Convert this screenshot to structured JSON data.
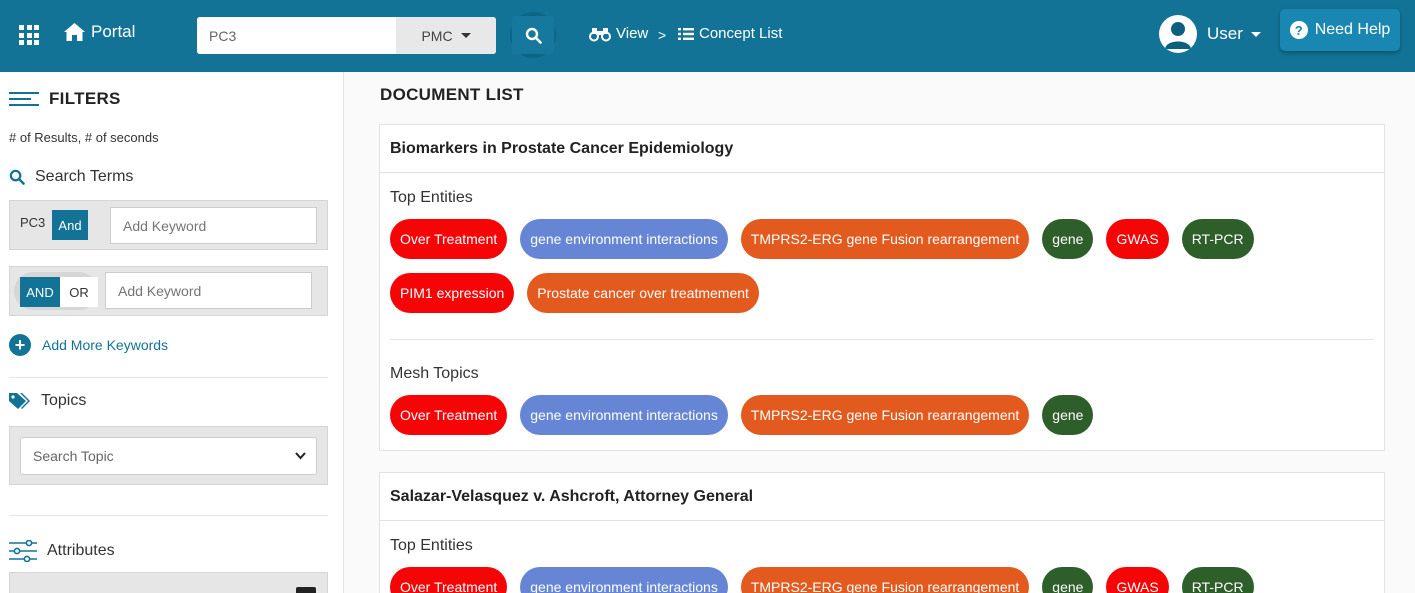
{
  "header": {
    "app_name": "Portal",
    "search": {
      "value": "PC3",
      "placeholder": ""
    },
    "source": "PMC",
    "breadcrumb": {
      "view": "View",
      "separator": ">",
      "concept_list": "Concept List"
    },
    "user": "User",
    "help": "Need Help",
    "help_mark": "?"
  },
  "sidebar": {
    "title": "FILTERS",
    "results_info": "# of Results, # of seconds",
    "search_terms_title": "Search Terms",
    "term1": {
      "keyword": "PC3",
      "operator": "And",
      "placeholder": "Add Keyword"
    },
    "term2": {
      "and_label": "AND",
      "or_label": "OR",
      "placeholder": "Add Keyword"
    },
    "add_more": "Add More Keywords",
    "topics_title": "Topics",
    "topic_placeholder": "Search Topic",
    "attributes_title": "Attributes"
  },
  "main": {
    "title": "DOCUMENT LIST",
    "documents": [
      {
        "title": "Biomarkers in Prostate Cancer Epidemiology",
        "top_entities_label": "Top Entities",
        "top_entities": [
          {
            "label": "Over Treatment",
            "color": "#f50505"
          },
          {
            "label": "gene environment interactions",
            "color": "#6685d4"
          },
          {
            "label": "TMPRS2-ERG gene Fusion rearrangement",
            "color": "#e35a1e"
          },
          {
            "label": "gene",
            "color": "#2e5f2b"
          },
          {
            "label": "GWAS",
            "color": "#f50505"
          },
          {
            "label": "RT-PCR",
            "color": "#2e5f2b"
          },
          {
            "label": "PIM1 expression",
            "color": "#f50505"
          },
          {
            "label": "Prostate cancer over treatmement",
            "color": "#e35a1e"
          }
        ],
        "mesh_label": "Mesh Topics",
        "mesh_topics": [
          {
            "label": "Over Treatment",
            "color": "#f50505"
          },
          {
            "label": "gene environment interactions",
            "color": "#6685d4"
          },
          {
            "label": "TMPRS2-ERG gene Fusion rearrangement",
            "color": "#e35a1e"
          },
          {
            "label": "gene",
            "color": "#2e5f2b"
          }
        ]
      },
      {
        "title": "Salazar-Velasquez v. Ashcroft, Attorney General",
        "top_entities_label": "Top Entities",
        "top_entities": [
          {
            "label": "Over Treatment",
            "color": "#f50505"
          },
          {
            "label": "gene environment interactions",
            "color": "#6685d4"
          },
          {
            "label": "TMPRS2-ERG gene Fusion rearrangement",
            "color": "#e35a1e"
          },
          {
            "label": "gene",
            "color": "#2e5f2b"
          },
          {
            "label": "GWAS",
            "color": "#f50505"
          },
          {
            "label": "RT-PCR",
            "color": "#2e5f2b"
          }
        ]
      }
    ]
  }
}
